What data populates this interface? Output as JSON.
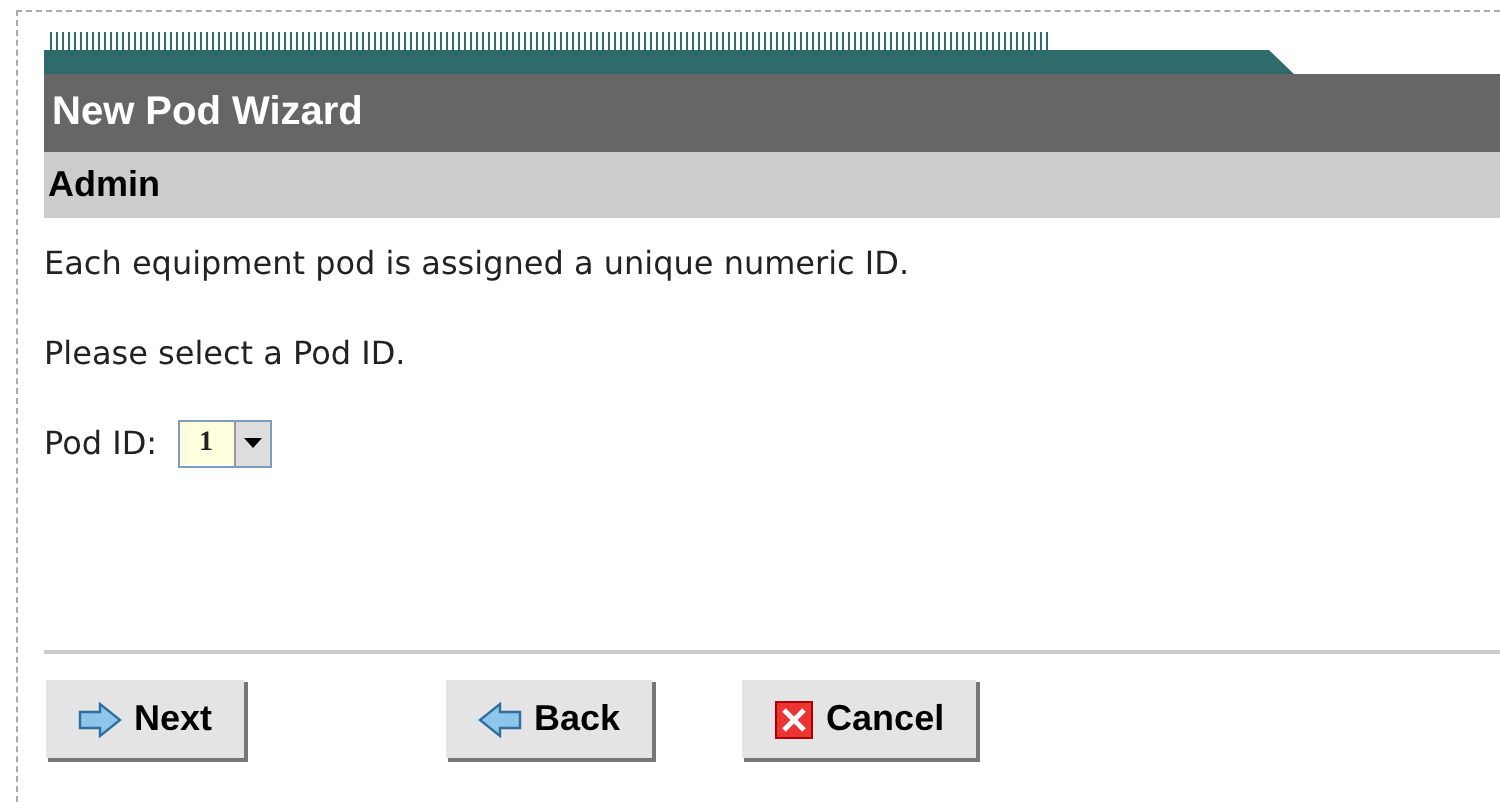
{
  "wizard": {
    "title": "New Pod Wizard",
    "subtitle": "Admin"
  },
  "paragraphs": [
    "Each equipment pod is assigned a unique numeric ID.",
    "Please select a Pod ID."
  ],
  "pod_id": {
    "label": "Pod ID:",
    "value": "1"
  },
  "buttons": [
    {
      "label": "Next",
      "kind": "next"
    },
    {
      "label": "Back",
      "kind": "back"
    },
    {
      "label": "Cancel",
      "kind": "cancel"
    }
  ]
}
